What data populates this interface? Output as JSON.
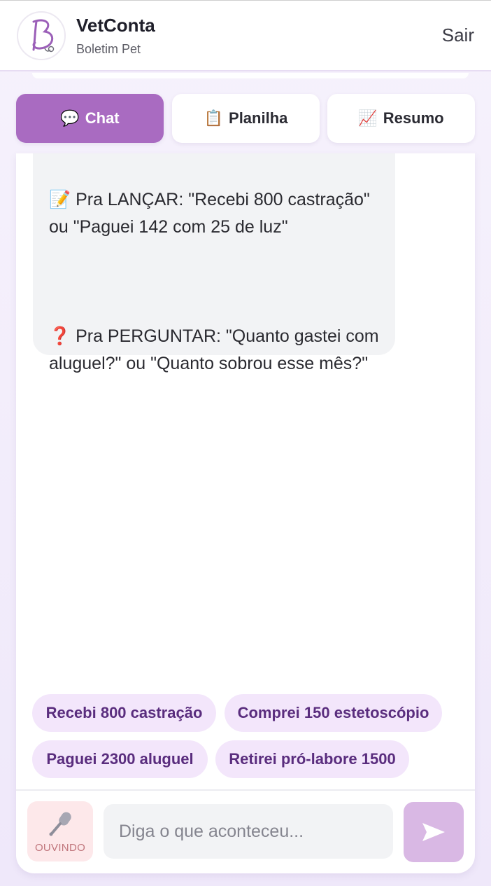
{
  "header": {
    "title": "VetConta",
    "subtitle": "Boletim Pet",
    "logout_label": "Sair",
    "logo_letter": "B"
  },
  "tabs": [
    {
      "label": "Chat",
      "icon": "speech-balloon-icon",
      "glyph": "💬",
      "active": true
    },
    {
      "label": "Planilha",
      "icon": "clipboard-icon",
      "glyph": "📋",
      "active": false
    },
    {
      "label": "Resumo",
      "icon": "chart-increasing-icon",
      "glyph": "📈",
      "active": false
    }
  ],
  "chat": {
    "message": {
      "line1": "📝 Pra LANÇAR: \"Recebi 800 castração\" ou \"Paguei 142 com 25 de luz\"",
      "line2": "❓ Pra PERGUNTAR: \"Quanto gastei com aluguel?\" ou \"Quanto sobrou esse mês?\""
    },
    "suggestions": [
      "Recebi 800 castração",
      "Comprei 150 estetoscópio",
      "Paguei 2300 aluguel",
      "Retirei pró-labore 1500"
    ]
  },
  "composer": {
    "mic_status": "OUVINDO",
    "placeholder": "Diga o que aconteceu...",
    "value": ""
  },
  "colors": {
    "accent": "#a96bc1",
    "chip_bg": "#f3e6fb",
    "chip_text": "#5a2d7e",
    "send_bg": "#d9b8e4",
    "mic_bg": "#fde8ea"
  }
}
